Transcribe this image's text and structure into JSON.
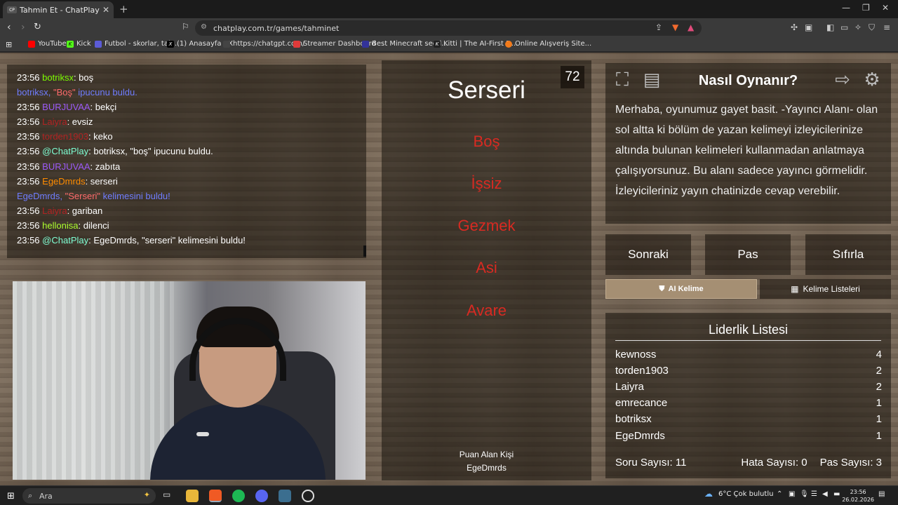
{
  "browser": {
    "tab_title": "Tahmin Et - ChatPlay",
    "tab_favicon": "CP",
    "url": "chatplay.com.tr/games/tahminet",
    "bookmarks": [
      {
        "label": "YouTube",
        "color": "#ff0000"
      },
      {
        "label": "Kick",
        "color": "#53fc18"
      },
      {
        "label": "Futbol - skorlar, tak...",
        "color": "#5b5bd6"
      },
      {
        "label": "(1) Anasayfa / X",
        "color": "#000000"
      },
      {
        "label": "https://chatgpt.com/",
        "color": "#444444"
      },
      {
        "label": "Streamer Dashboard",
        "color": "#e03a3a"
      },
      {
        "label": "Best Minecraft seed...",
        "color": "#333399"
      },
      {
        "label": "Kitti | The AI-First D...",
        "color": "#222222"
      },
      {
        "label": "Online Alışveriş Site...",
        "color": "#f27a1a"
      }
    ]
  },
  "chat": {
    "messages": [
      {
        "type": "user",
        "time": "23:56",
        "user": "botriksx",
        "color": "#7cfc00",
        "text": ": boş"
      },
      {
        "type": "system",
        "pre": "botriksx, ",
        "highlight": "\"Boş\"",
        "post": " ipucunu buldu."
      },
      {
        "type": "user",
        "time": "23:56",
        "user": "BURJUVAA",
        "color": "#9b59f6",
        "text": ": bekçi"
      },
      {
        "type": "user",
        "time": "23:56",
        "user": "Laiyra",
        "color": "#b22222",
        "text": ": evsiz"
      },
      {
        "type": "user",
        "time": "23:56",
        "user": "torden1903",
        "color": "#b22222",
        "text": ": keko"
      },
      {
        "type": "user",
        "time": "23:56",
        "user": "@ChatPlay",
        "color": "#7fffd4",
        "text": ": botriksx, \"boş\" ipucunu buldu."
      },
      {
        "type": "user",
        "time": "23:56",
        "user": "BURJUVAA",
        "color": "#9b59f6",
        "text": ": zabıta"
      },
      {
        "type": "user",
        "time": "23:56",
        "user": "EgeDmrds",
        "color": "#ff8c00",
        "text": ": serseri"
      },
      {
        "type": "system",
        "pre": "EgeDmrds, ",
        "highlight": "\"Serseri\"",
        "post": " kelimesini buldu!"
      },
      {
        "type": "user",
        "time": "23:56",
        "user": "Laiyra",
        "color": "#b22222",
        "text": ": gariban"
      },
      {
        "type": "user",
        "time": "23:56",
        "user": "hellonisa",
        "color": "#adff2f",
        "text": ": dilenci"
      },
      {
        "type": "user",
        "time": "23:56",
        "user": "@ChatPlay",
        "color": "#7fffd4",
        "text": ": EgeDmrds, \"serseri\" kelimesini buldu!"
      }
    ]
  },
  "game": {
    "timer": "72",
    "word": "Serseri",
    "forbidden": [
      "Boş",
      "İşsiz",
      "Gezmek",
      "Asi",
      "Avare"
    ],
    "scorer_label": "Puan Alan Kişi",
    "scorer_name": "EgeDmrds"
  },
  "how_to_play": {
    "title": "Nasıl Oynanır?",
    "text": "Merhaba, oyunumuz gayet basit. -Yayıncı Alanı- olan sol altta ki bölüm de yazan kelimeyi izleyicilerinize altında bulunan kelimeleri kullanmadan anlatmaya çalışıyorsunuz. Bu alanı sadece yayıncı görmelidir. İzleyicileriniz yayın chatinizde cevap verebilir."
  },
  "controls": {
    "next": "Sonraki",
    "pass": "Pas",
    "reset": "Sıfırla",
    "tab_ai": "AI Kelime",
    "tab_lists": "Kelime Listeleri"
  },
  "leaderboard": {
    "title": "Liderlik Listesi",
    "rows": [
      {
        "name": "kewnoss",
        "score": "4"
      },
      {
        "name": "torden1903",
        "score": "2"
      },
      {
        "name": "Laiyra",
        "score": "2"
      },
      {
        "name": "emrecance",
        "score": "1"
      },
      {
        "name": "botriksx",
        "score": "1"
      },
      {
        "name": "EgeDmrds",
        "score": "1"
      }
    ],
    "question_count": "Soru Sayısı: 11",
    "error_count": "Hata Sayısı: 0",
    "pass_count": "Pas Sayısı: 3"
  },
  "taskbar": {
    "search_placeholder": "Ara",
    "weather": "6°C  Çok bulutlu",
    "time": "23:56",
    "date": "26.02.2026"
  },
  "colors": {
    "forbidden": "#d82a22",
    "system_msg": "#6f7dff",
    "highlight": "#ff6b6b"
  }
}
